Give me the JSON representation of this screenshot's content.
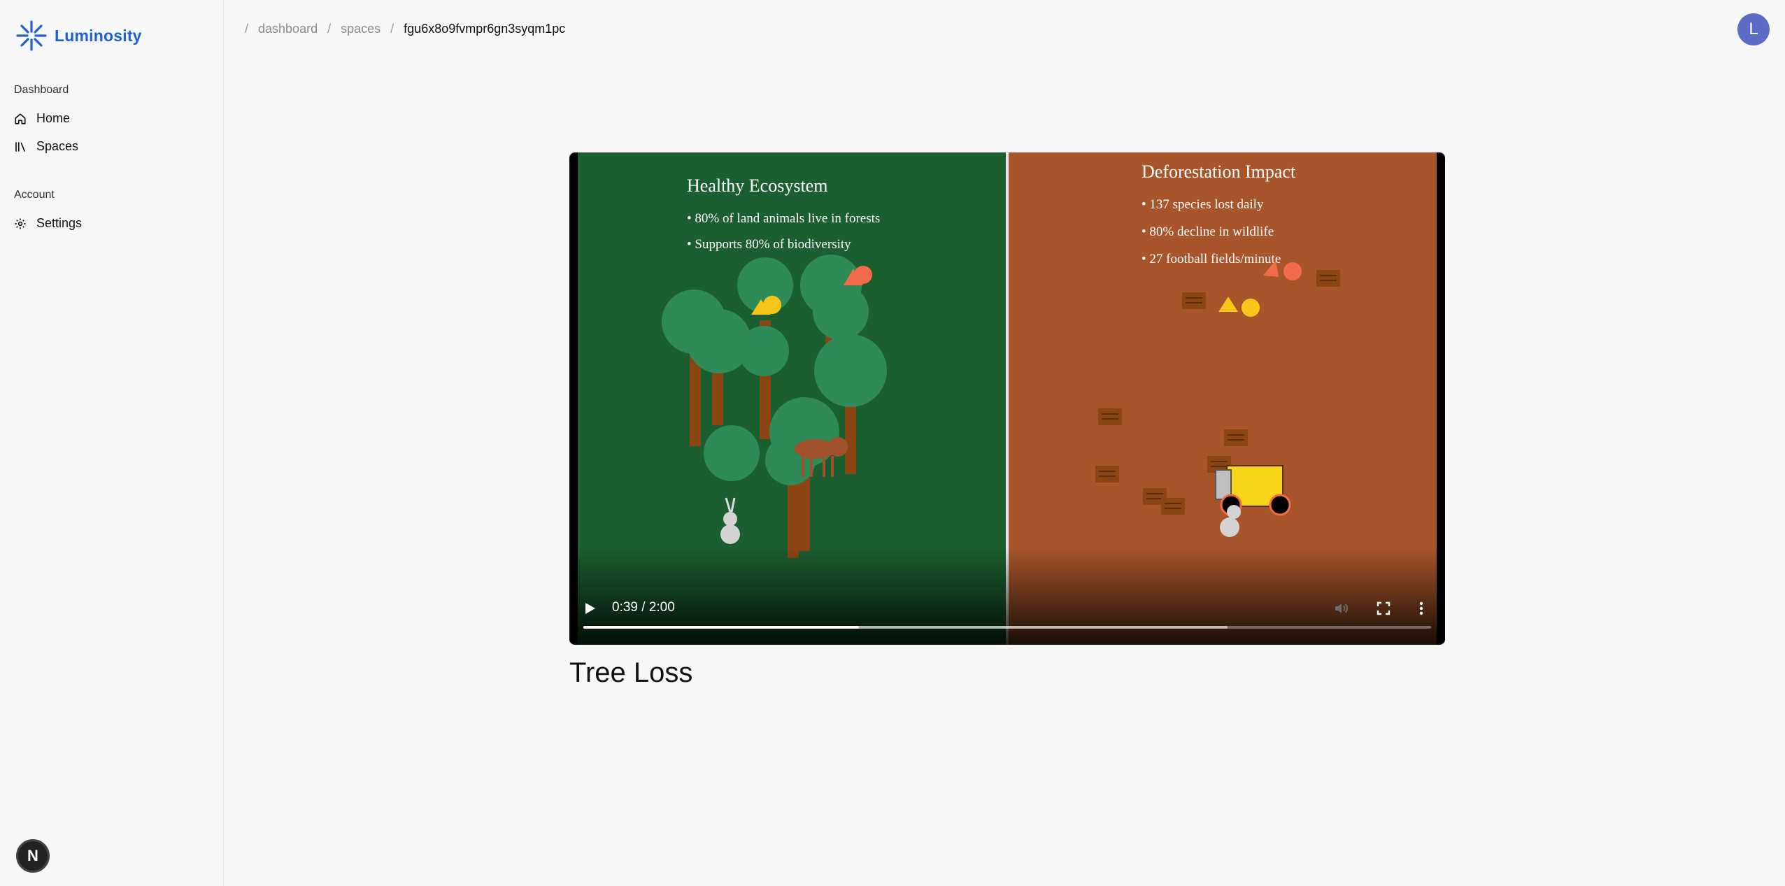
{
  "app": {
    "name": "Luminosity"
  },
  "sidebar": {
    "sections": [
      {
        "label": "Dashboard",
        "items": [
          {
            "label": "Home",
            "icon": "home-icon"
          },
          {
            "label": "Spaces",
            "icon": "library-icon"
          }
        ]
      },
      {
        "label": "Account",
        "items": [
          {
            "label": "Settings",
            "icon": "gear-icon"
          }
        ]
      }
    ],
    "dev_badge": "N"
  },
  "breadcrumb": {
    "items": [
      "dashboard",
      "spaces",
      "fgu6x8o9fvmpr6gn3syqm1pc"
    ]
  },
  "user": {
    "avatar_initial": "L",
    "avatar_color": "#5b6bc6"
  },
  "video": {
    "time_display": "0:39 / 2:00",
    "progress_fraction": 0.325,
    "buffered_fraction": 0.76,
    "left_panel": {
      "title": "Healthy Ecosystem",
      "bullets": [
        "• 80% of land animals live in forests",
        "• Supports 80% of biodiversity"
      ],
      "color": "#1b5e30"
    },
    "right_panel": {
      "title": "Deforestation Impact",
      "bullets": [
        "• 137 species lost daily",
        "• 80% decline in wildlife",
        "• 27 football fields/minute"
      ],
      "color": "#a8552b"
    }
  },
  "content": {
    "title": "Tree Loss"
  },
  "colors": {
    "accent": "#1f5fcf"
  }
}
